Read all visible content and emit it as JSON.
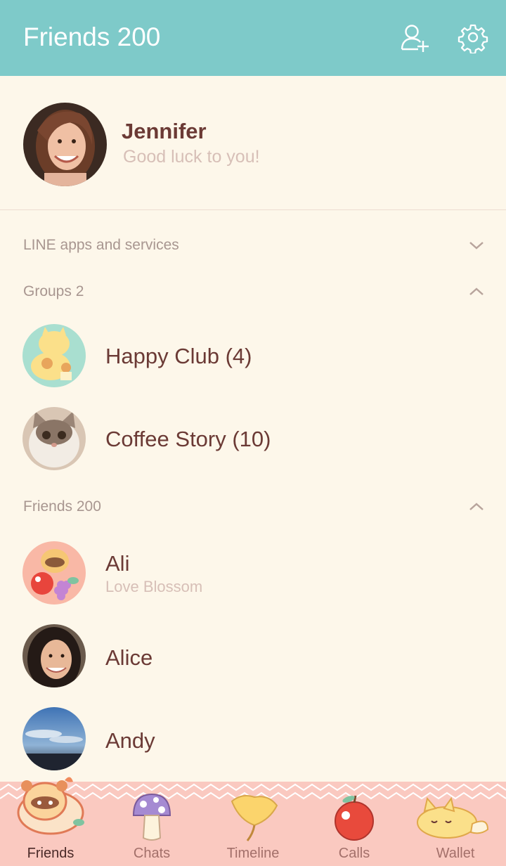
{
  "header": {
    "title": "Friends 200"
  },
  "profile": {
    "name": "Jennifer",
    "status": "Good luck to you!"
  },
  "sections": {
    "services": "LINE apps and services",
    "groups": "Groups 2",
    "friends": "Friends 200"
  },
  "groups": [
    {
      "title": "Happy Club (4)"
    },
    {
      "title": "Coffee Story (10)"
    }
  ],
  "friends": [
    {
      "name": "Ali",
      "status": "Love Blossom"
    },
    {
      "name": "Alice"
    },
    {
      "name": "Andy"
    }
  ],
  "tabs": [
    {
      "label": "Friends",
      "icon": "tanuki-icon"
    },
    {
      "label": "Chats",
      "icon": "mushroom-icon"
    },
    {
      "label": "Timeline",
      "icon": "ginkgo-leaf-icon"
    },
    {
      "label": "Calls",
      "icon": "apple-icon"
    },
    {
      "label": "Wallet",
      "icon": "cat-icon"
    }
  ],
  "colors": {
    "header": "#7ecac9",
    "background": "#fdf7ea",
    "tabbar": "#fac9c0",
    "text": "#6b3a35"
  }
}
